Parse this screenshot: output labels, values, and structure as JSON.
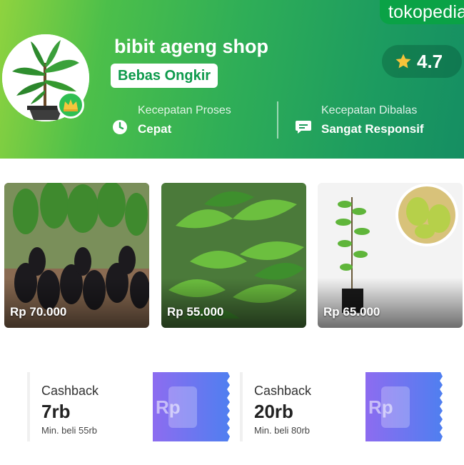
{
  "brand": "tokopedia",
  "shop": {
    "name": "bibit ageng shop",
    "badge": "Bebas Ongkir",
    "rating": "4.7"
  },
  "stats": [
    {
      "label": "Kecepatan Proses",
      "value": "Cepat",
      "icon": "clock-icon"
    },
    {
      "label": "Kecepatan Dibalas",
      "value": "Sangat Responsif",
      "icon": "chat-icon"
    }
  ],
  "products": [
    {
      "price": "Rp 70.000"
    },
    {
      "price": "Rp 55.000"
    },
    {
      "price": "Rp 65.000"
    }
  ],
  "vouchers": [
    {
      "title": "Cashback",
      "amount": "7rb",
      "min": "Min. beli 55rb",
      "icon_text": "Rp"
    },
    {
      "title": "Cashback",
      "amount": "20rb",
      "min": "Min. beli 80rb",
      "icon_text": "Rp"
    }
  ],
  "colors": {
    "brand_green": "#0aa246",
    "badge_green": "#0e9a4c",
    "star": "#f6c33a",
    "voucher_purple": "#8d6cf0",
    "voucher_blue": "#4f7ff0"
  }
}
